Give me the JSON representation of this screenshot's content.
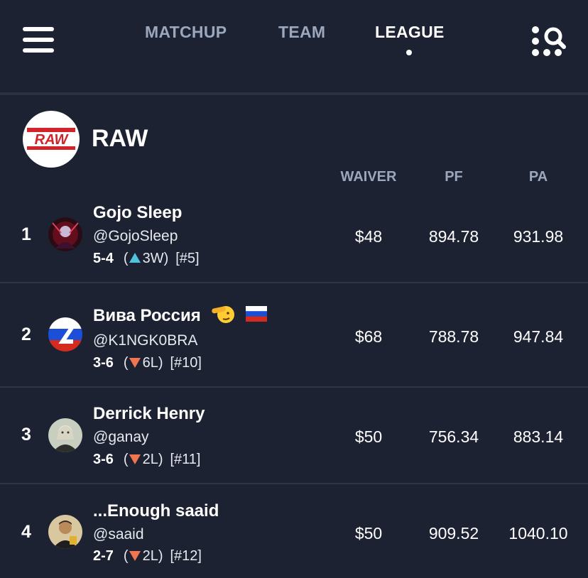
{
  "nav": {
    "tabs": [
      {
        "label": "MATCHUP",
        "active": false
      },
      {
        "label": "TEAM",
        "active": false
      },
      {
        "label": "LEAGUE",
        "active": true
      }
    ],
    "menu_icon": "hamburger-menu-icon",
    "search_icon": "search-grid-icon"
  },
  "league": {
    "name": "RAW",
    "logo_text": "RAW",
    "logo_color": "#d2232a"
  },
  "columns": {
    "waiver": "WAIVER",
    "pf": "PF",
    "pa": "PA"
  },
  "colors": {
    "background": "#1d2232",
    "muted_text": "#9aa7bd",
    "streak_win": "#4fc3dd",
    "streak_loss": "#ef7650"
  },
  "standings": [
    {
      "rank": "1",
      "name": "Gojo Sleep",
      "handle": "@GojoSleep",
      "record": "5-4",
      "streak_dir": "up",
      "streak_text": "3W)",
      "seed": "[#5]",
      "waiver": "$48",
      "pf": "894.78",
      "pa": "931.98"
    },
    {
      "rank": "2",
      "name": "Вива Россия",
      "handle": "@K1NGK0BRA",
      "record": "3-6",
      "streak_dir": "down",
      "streak_text": "6L)",
      "seed": "[#10]",
      "waiver": "$68",
      "pf": "788.78",
      "pa": "947.84"
    },
    {
      "rank": "3",
      "name": "Derrick Henry",
      "handle": "@ganay",
      "record": "3-6",
      "streak_dir": "down",
      "streak_text": "2L)",
      "seed": "[#11]",
      "waiver": "$50",
      "pf": "756.34",
      "pa": "883.14"
    },
    {
      "rank": "4",
      "name": "...Enough saaid",
      "handle": "@saaid",
      "record": "2-7",
      "streak_dir": "down",
      "streak_text": "2L)",
      "seed": "[#12]",
      "waiver": "$50",
      "pf": "909.52",
      "pa": "1040.10"
    }
  ]
}
